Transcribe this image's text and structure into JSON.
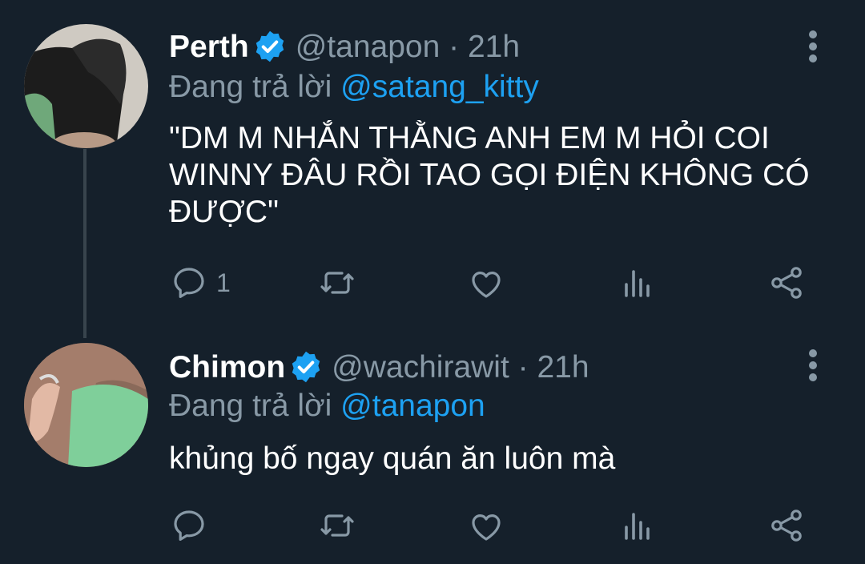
{
  "tweets": [
    {
      "name": "Perth",
      "handle": "@tanapon",
      "time": "· 21h",
      "reply_prefix": "Đang trả lời",
      "reply_to": "@satang_kitty",
      "text": "\"DM M NHẮN THẰNG ANH EM M HỎI COI WINNY ĐÂU RỒI TAO GỌI ĐIỆN KHÔNG CÓ ĐƯỢC\"",
      "reply_count": "1"
    },
    {
      "name": "Chimon",
      "handle": "@wachirawit",
      "time": "· 21h",
      "reply_prefix": "Đang trả lời",
      "reply_to": "@tanapon",
      "text": "khủng bố ngay quán ăn luôn mà",
      "reply_count": ""
    }
  ],
  "icons": {
    "verified": "verified-badge-icon",
    "reply": "reply-icon",
    "retweet": "retweet-icon",
    "like": "like-icon",
    "analytics": "analytics-icon",
    "share": "share-icon",
    "more": "more-vertical-icon"
  },
  "colors": {
    "background": "#15202b",
    "muted": "#8899a6",
    "accent": "#1da1f2",
    "thread_line": "#38444d"
  }
}
